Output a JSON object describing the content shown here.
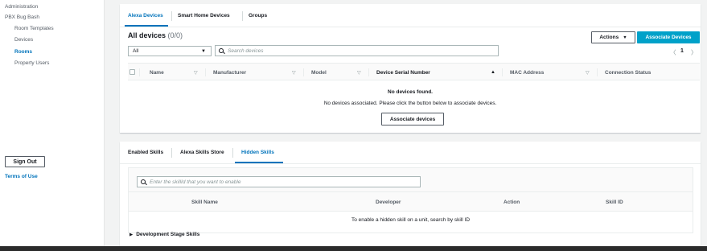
{
  "sidebar": {
    "items": [
      {
        "label": "Administration",
        "active": false
      },
      {
        "label": "PBX Bug Bash",
        "active": false
      },
      {
        "label": "Room Templates",
        "active": false
      },
      {
        "label": "Devices",
        "active": false
      },
      {
        "label": "Rooms",
        "active": true
      },
      {
        "label": "Property Users",
        "active": false
      }
    ],
    "sign_out": "Sign Out",
    "terms": "Terms of Use"
  },
  "devices_panel": {
    "tabs": [
      "Alexa Devices",
      "Smart Home Devices",
      "Groups"
    ],
    "active_tab": "Alexa Devices",
    "title": "All devices",
    "count": "(0/0)",
    "actions_button": "Actions",
    "associate_button": "Associate Devices",
    "filter_select": "All",
    "search_placeholder": "Search devices",
    "pager": {
      "prev": "〈",
      "page": "1",
      "next": "〉"
    },
    "columns": [
      "Name",
      "Manufacturer",
      "Model",
      "Device Serial Number",
      "MAC Address",
      "Connection Status"
    ],
    "sorted_column": "Device Serial Number",
    "empty_title": "No devices found.",
    "empty_message": "No devices associated. Please click the button below to associate devices.",
    "empty_button": "Associate devices"
  },
  "skills_panel": {
    "tabs": [
      "Enabled Skills",
      "Alexa Skills Store",
      "Hidden Skills"
    ],
    "active_tab": "Hidden Skills",
    "search_placeholder": "Enter the skillId that you want to enable",
    "columns": [
      "Skill Name",
      "Developer",
      "Action",
      "Skill ID"
    ],
    "empty_message": "To enable a hidden skill on a unit, search by skill ID",
    "dev_stage": "Development Stage Skills"
  },
  "colors": {
    "accent": "#0073bb",
    "primary_button": "#00a1c9"
  }
}
